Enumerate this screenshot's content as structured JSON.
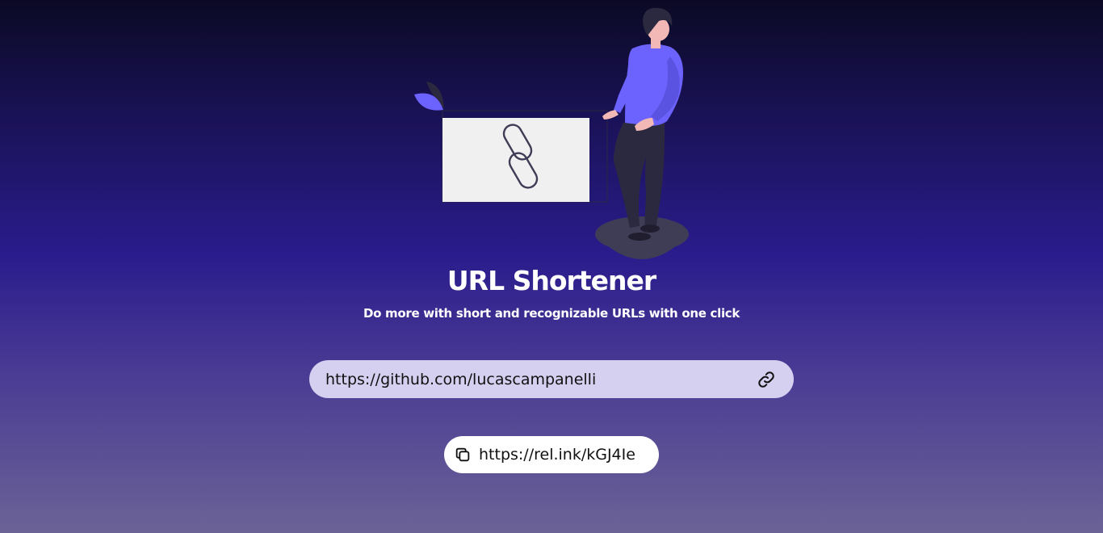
{
  "header": {
    "title": "URL Shortener",
    "subtitle": "Do more with short and recognizable URLs with one click"
  },
  "shortener": {
    "input_value": "https://github.com/lucascampanelli",
    "input_placeholder": "",
    "submit_icon": "link-icon"
  },
  "result": {
    "short_url": "https://rel.ink/kGJ4Ie",
    "copy_icon": "copy-icon"
  },
  "colors": {
    "accent": "#6c63ff",
    "input_bg": "#d5cff0",
    "result_bg": "#ffffff"
  }
}
